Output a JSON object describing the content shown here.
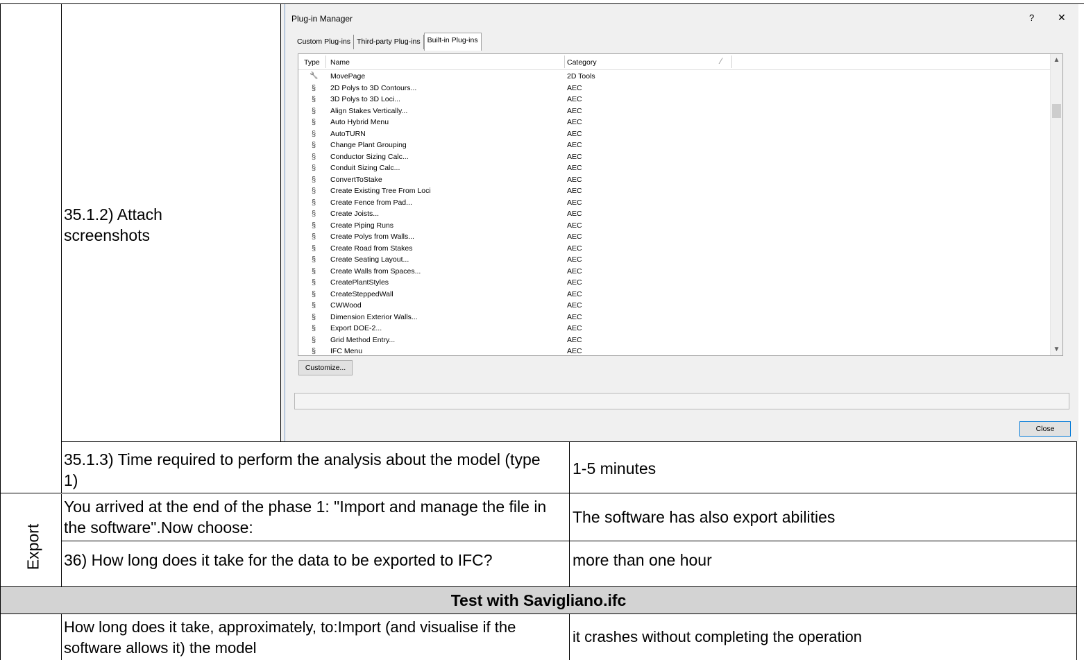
{
  "table": {
    "row_attach": {
      "label": "35.1.2) Attach screenshots"
    },
    "row_time": {
      "question": "35.1.3) Time required to perform the analysis about the model (type 1)",
      "answer": "1-5 minutes"
    },
    "section_export": "Export",
    "row_end": {
      "question": "You arrived at the end of the phase 1: \"Import and manage the file in the software\".Now choose:",
      "answer": "The software has also export abilities"
    },
    "row_36": {
      "question": "36) How long does it take for the data to be exported to IFC?",
      "answer": "more than one hour"
    },
    "test_header": "Test with Savigliano.ifc",
    "row_import": {
      "question": "How long does it take, approximately, to:Import (and visualise if the software allows it) the model",
      "answer": "it crashes without completing the operation"
    }
  },
  "dialog": {
    "title": "Plug-in Manager",
    "help_label": "?",
    "close_glyph": "✕",
    "tabs": [
      {
        "label": "Custom Plug-ins"
      },
      {
        "label": "Third-party Plug-ins"
      },
      {
        "label": "Built-in Plug-ins"
      }
    ],
    "columns": {
      "type": "Type",
      "name": "Name",
      "category": "Category"
    },
    "plugins": [
      {
        "icon": "wrench-icon",
        "name": "MovePage",
        "category": "2D Tools"
      },
      {
        "icon": "plugin-icon",
        "name": "2D Polys to 3D Contours...",
        "category": "AEC"
      },
      {
        "icon": "plugin-icon",
        "name": "3D Polys to 3D Loci...",
        "category": "AEC"
      },
      {
        "icon": "plugin-icon",
        "name": "Align Stakes Vertically...",
        "category": "AEC"
      },
      {
        "icon": "plugin-icon",
        "name": "Auto Hybrid Menu",
        "category": "AEC"
      },
      {
        "icon": "plugin-icon",
        "name": "AutoTURN",
        "category": "AEC"
      },
      {
        "icon": "plugin-icon",
        "name": "Change Plant Grouping",
        "category": "AEC"
      },
      {
        "icon": "plugin-icon",
        "name": "Conductor Sizing Calc...",
        "category": "AEC"
      },
      {
        "icon": "plugin-icon",
        "name": "Conduit Sizing Calc...",
        "category": "AEC"
      },
      {
        "icon": "plugin-icon",
        "name": "ConvertToStake",
        "category": "AEC"
      },
      {
        "icon": "plugin-icon",
        "name": "Create Existing Tree From Loci",
        "category": "AEC"
      },
      {
        "icon": "plugin-icon",
        "name": "Create Fence from Pad...",
        "category": "AEC"
      },
      {
        "icon": "plugin-icon",
        "name": "Create Joists...",
        "category": "AEC"
      },
      {
        "icon": "plugin-icon",
        "name": "Create Piping Runs",
        "category": "AEC"
      },
      {
        "icon": "plugin-icon",
        "name": "Create Polys from Walls...",
        "category": "AEC"
      },
      {
        "icon": "plugin-icon",
        "name": "Create Road from Stakes",
        "category": "AEC"
      },
      {
        "icon": "plugin-icon",
        "name": "Create Seating Layout...",
        "category": "AEC"
      },
      {
        "icon": "plugin-icon",
        "name": "Create Walls from Spaces...",
        "category": "AEC"
      },
      {
        "icon": "plugin-icon",
        "name": "CreatePlantStyles",
        "category": "AEC"
      },
      {
        "icon": "plugin-icon",
        "name": "CreateSteppedWall",
        "category": "AEC"
      },
      {
        "icon": "plugin-icon",
        "name": "CWWood",
        "category": "AEC"
      },
      {
        "icon": "plugin-icon",
        "name": "Dimension Exterior Walls...",
        "category": "AEC"
      },
      {
        "icon": "plugin-icon",
        "name": "Export DOE-2...",
        "category": "AEC"
      },
      {
        "icon": "plugin-icon",
        "name": "Grid Method Entry...",
        "category": "AEC"
      },
      {
        "icon": "plugin-icon",
        "name": "IFC Menu",
        "category": "AEC"
      }
    ],
    "customize_label": "Customize...",
    "close_label": "Close"
  }
}
